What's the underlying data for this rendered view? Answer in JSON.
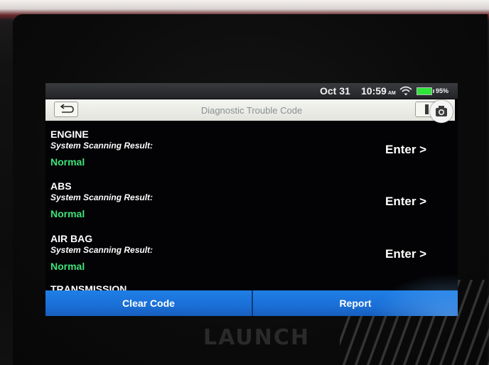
{
  "status": {
    "date": "Oct 31",
    "time": "10:59",
    "ampm": "AM",
    "battery": "95%"
  },
  "header": {
    "title": "Diagnostic Trouble Code"
  },
  "systems": [
    {
      "name": "ENGINE",
      "result_label": "System Scanning Result:",
      "status": "Normal",
      "enter_label": "Enter >"
    },
    {
      "name": "ABS",
      "result_label": "System Scanning Result:",
      "status": "Normal",
      "enter_label": "Enter >"
    },
    {
      "name": "AIR BAG",
      "result_label": "System Scanning Result:",
      "status": "Normal",
      "enter_label": "Enter >"
    },
    {
      "name": "TRANSMISSION"
    }
  ],
  "footer": {
    "clear_label": "Clear Code",
    "report_label": "Report"
  },
  "device": {
    "brand": "LAUNCH"
  },
  "colors": {
    "status_ok": "#3fe27a",
    "button_blue": "#1f7fe6",
    "title_bar": "#f4f5f0",
    "battery": "#2fe43a"
  },
  "icons": {
    "back": "back-arrow-icon",
    "print": "print-icon",
    "camera": "camera-icon",
    "wifi": "wifi-icon",
    "battery": "battery-icon"
  }
}
